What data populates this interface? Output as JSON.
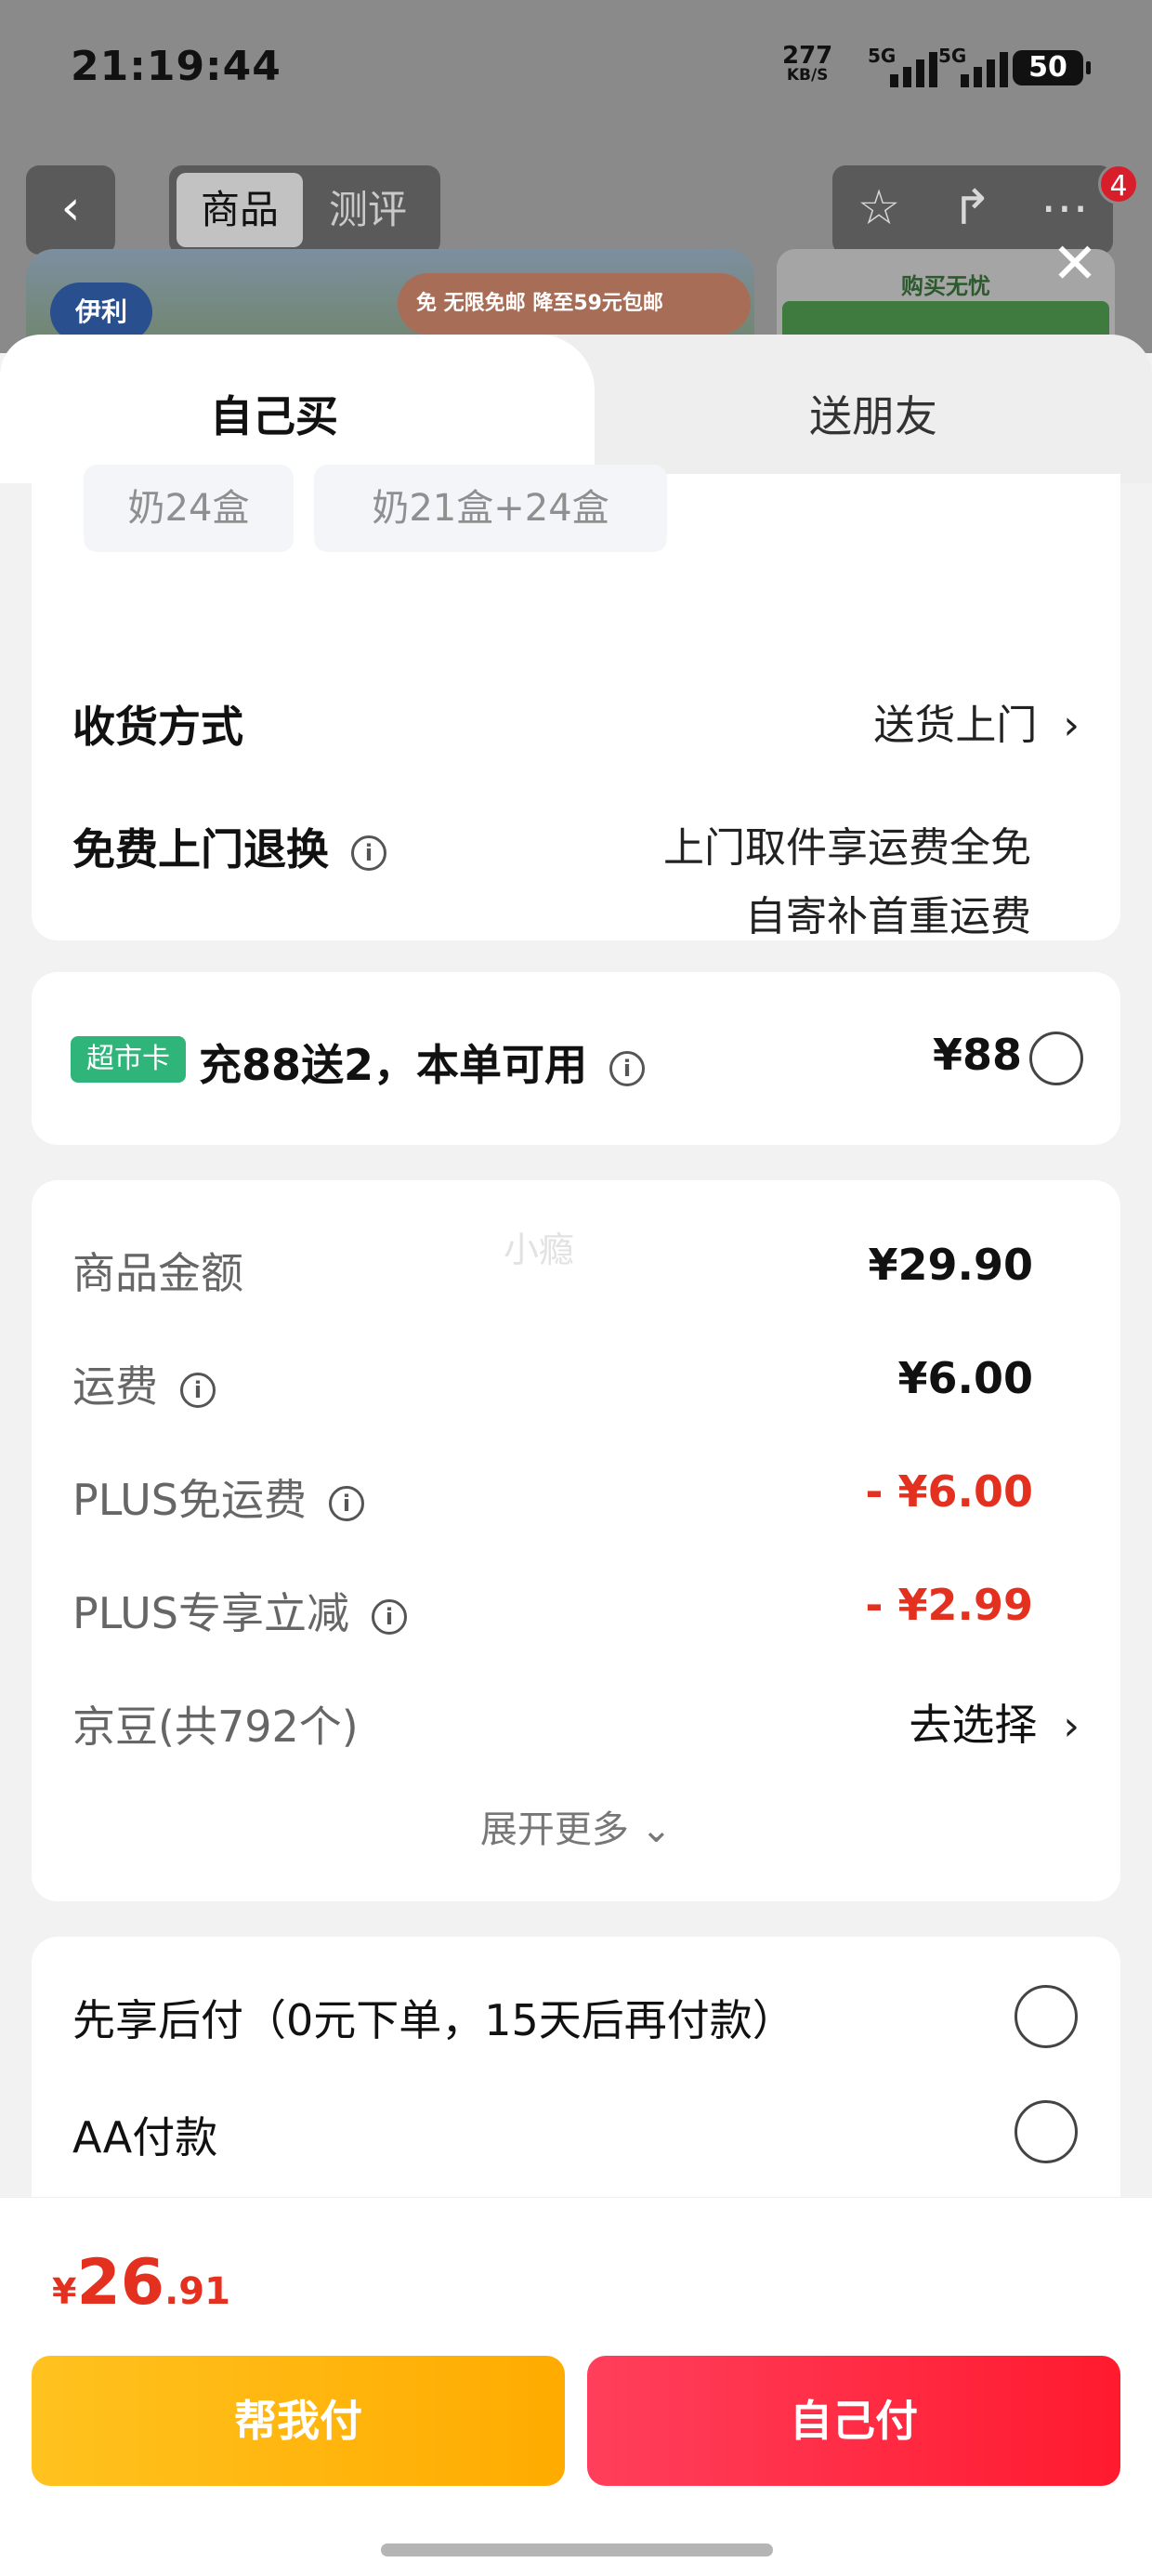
{
  "status_bar": {
    "time": "21:19:44",
    "net_speed": "277",
    "net_unit": "KB/S",
    "signal1": "5G",
    "signal2": "5G",
    "battery": "50"
  },
  "header": {
    "tab_goods": "商品",
    "tab_reviews": "测评",
    "cart_badge": "4",
    "banner_logo": "伊利",
    "banner_promo": "免 无限免邮 降至59元包邮",
    "side_card_text": "购买无忧"
  },
  "sheet": {
    "tab_self": "自己买",
    "tab_friend": "送朋友"
  },
  "options": [
    {
      "label": "奶24盒"
    },
    {
      "label": "奶21盒+24盒"
    }
  ],
  "delivery": {
    "label": "收货方式",
    "value": "送货上门"
  },
  "returns": {
    "label": "免费上门退换",
    "line1": "上门取件享运费全免",
    "line2": "自寄补首重运费"
  },
  "market_card": {
    "tag": "超市卡",
    "text": "充88送2，本单可用",
    "price": "¥88"
  },
  "fees": {
    "watermark": "小瘾",
    "rows": [
      {
        "label": "商品金额",
        "value": "¥29.90"
      },
      {
        "label": "运费",
        "value": "¥6.00"
      },
      {
        "label": "PLUS免运费",
        "value": "- ¥6.00"
      },
      {
        "label": "PLUS专享立减",
        "value": "- ¥2.99"
      },
      {
        "label": "京豆(共792个)",
        "value": "去选择"
      }
    ],
    "expand": "展开更多"
  },
  "payment": {
    "pay_later": "先享后付（0元下单，15天后再付款）",
    "aa_pay": "AA付款"
  },
  "bottom": {
    "currency": "¥",
    "total_int": "26",
    "total_dec": ".91",
    "help_pay": "帮我付",
    "self_pay": "自己付"
  },
  "colors": {
    "accent_red": "#e3301f",
    "tag_green": "#2fb57a",
    "btn_yellow": "#ffb300",
    "btn_red": "#ff1a2e"
  }
}
